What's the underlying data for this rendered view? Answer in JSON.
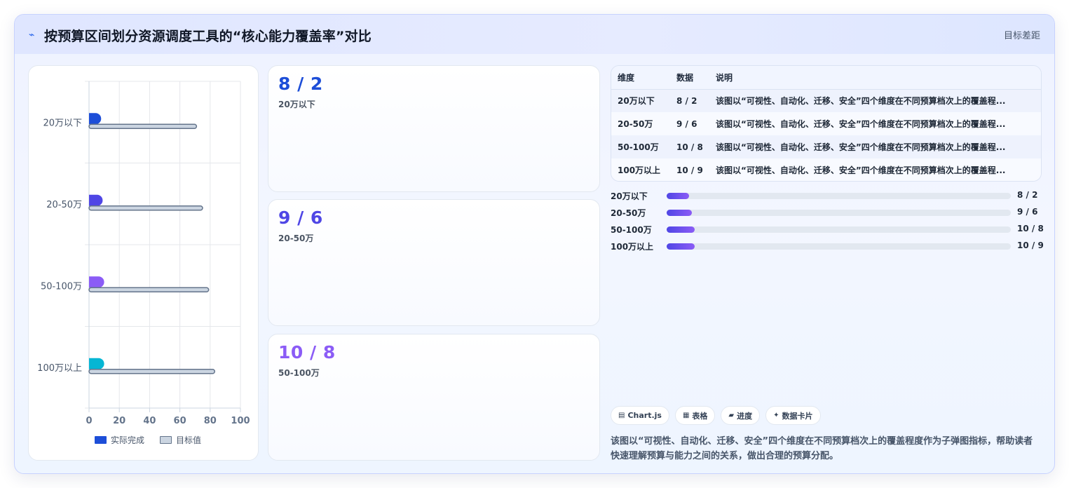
{
  "header": {
    "logo_icon": "sparkline-icon",
    "logo_glyph": "⌁",
    "title": "按预算区间划分资源调度工具的“核心能力覆盖率”对比",
    "target_label": "目标差距"
  },
  "chart_data": {
    "type": "bar",
    "orientation": "horizontal",
    "categories": [
      "20万以下",
      "20-50万",
      "50-100万",
      "100万以上"
    ],
    "series": [
      {
        "name": "实际完成",
        "values": [
          8,
          9,
          10,
          10
        ],
        "colors": [
          "#1d4ed8",
          "#4f46e5",
          "#8b5cf6",
          "#06b6d4"
        ]
      },
      {
        "name": "目标值",
        "values": [
          71,
          75,
          79,
          83
        ],
        "color": "#cbd5e1",
        "border": "#64748b"
      }
    ],
    "xlim": [
      0,
      100
    ],
    "xticks": [
      "0",
      "20",
      "40",
      "60",
      "80",
      "100"
    ],
    "grid": true,
    "legend_position": "bottom"
  },
  "kpis": [
    {
      "value": "8 / 2",
      "label": "20万以下",
      "color": "#1d4ed8"
    },
    {
      "value": "9 / 6",
      "label": "20-50万",
      "color": "#4f46e5"
    },
    {
      "value": "10 / 8",
      "label": "50-100万",
      "color": "#8b5cf6"
    }
  ],
  "table": {
    "headers": [
      "维度",
      "数据",
      "说明"
    ],
    "rows": [
      [
        "20万以下",
        "8 / 2",
        "该图以“可视性、自动化、迁移、安全”四个维度在不同预算档次上的覆盖程..."
      ],
      [
        "20-50万",
        "9 / 6",
        "该图以“可视性、自动化、迁移、安全”四个维度在不同预算档次上的覆盖程..."
      ],
      [
        "50-100万",
        "10 / 8",
        "该图以“可视性、自动化、迁移、安全”四个维度在不同预算档次上的覆盖程..."
      ],
      [
        "100万以上",
        "10 / 9",
        "该图以“可视性、自动化、迁移、安全”四个维度在不同预算档次上的覆盖程..."
      ]
    ]
  },
  "progress": [
    {
      "label": "20万以下",
      "value": "8 / 2",
      "fraction": 0.066
    },
    {
      "label": "20-50万",
      "value": "9 / 6",
      "fraction": 0.074
    },
    {
      "label": "50-100万",
      "value": "10 / 8",
      "fraction": 0.082
    },
    {
      "label": "100万以上",
      "value": "10 / 9",
      "fraction": 0.082
    }
  ],
  "pills": [
    {
      "icon": "▤",
      "label": "Chart.js"
    },
    {
      "icon": "▦",
      "label": "表格"
    },
    {
      "icon": "▰",
      "label": "进度"
    },
    {
      "icon": "✦",
      "label": "数据卡片"
    }
  ],
  "description": "该图以“可视性、自动化、迁移、安全”四个维度在不同预算档次上的覆盖程度作为子弹图指标，帮助读者快速理解预算与能力之间的关系，做出合理的预算分配。"
}
